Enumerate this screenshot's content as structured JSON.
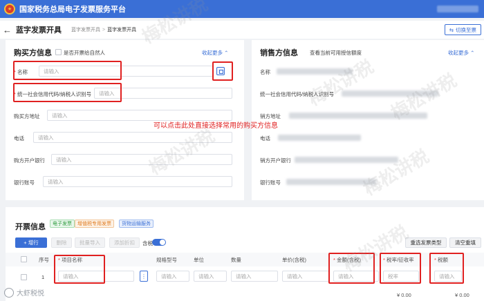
{
  "app": {
    "title": "国家税务总局电子发票服务平台"
  },
  "header": {
    "page_title": "蓝字发票开具",
    "breadcrumb": [
      "蓝字发票开具",
      "蓝字发票开具"
    ],
    "switch_label": "切换至票"
  },
  "buyer": {
    "title": "购买方信息",
    "natural_person_label": "是否开票给自然人",
    "collapse_label": "收起更多 ⌃",
    "fields": [
      {
        "label": "名称",
        "required": true,
        "placeholder": "请输入"
      },
      {
        "label": "统一社会信用代码/纳税人识别号",
        "required": true,
        "placeholder": "请输入"
      },
      {
        "label": "购买方地址",
        "required": false,
        "placeholder": "请输入"
      },
      {
        "label": "电话",
        "required": false,
        "placeholder": "请输入"
      },
      {
        "label": "购方开户银行",
        "required": false,
        "placeholder": "请输入"
      },
      {
        "label": "银行账号",
        "required": false,
        "placeholder": "请输入"
      }
    ],
    "annotation": "可以点击此处直接选择常用的购买方信息"
  },
  "seller": {
    "title": "销售方信息",
    "credit_link": "查看当前可用授信额度",
    "collapse_label": "收起更多 ⌃",
    "fields": [
      {
        "label": "名称"
      },
      {
        "label": "统一社会信用代码/纳税人识别号"
      },
      {
        "label": "销方地址"
      },
      {
        "label": "电话"
      },
      {
        "label": "销方开户银行"
      },
      {
        "label": "银行账号"
      }
    ]
  },
  "invoice": {
    "title": "开票信息",
    "tags": [
      "电子发票",
      "增值税专用发票",
      "货物运输服务"
    ],
    "buttons": {
      "add_row": "+ 增行",
      "delete": "删除",
      "batch_import": "批量导入",
      "add_discount": "添加折扣",
      "tax_included": "含税",
      "reselect_type": "重选发票类型",
      "clear": "清空重填"
    },
    "columns": {
      "index": "序号",
      "item_name": "项目名称",
      "spec": "规格型号",
      "unit": "单位",
      "quantity": "数量",
      "unit_price": "单价(含税)",
      "amount": "金额(含税)",
      "tax_rate": "税率/征收率",
      "tax": "税额"
    },
    "row": {
      "index": "1",
      "item_placeholder": "请输入",
      "dots": "⋮",
      "spec_placeholder": "请输入",
      "unit_placeholder": "请输入",
      "qty_placeholder": "请输入",
      "price_placeholder": "请输入",
      "amount_placeholder": "请输入",
      "rate_placeholder": "税率",
      "tax_placeholder": "请输入"
    },
    "totals": {
      "amount": "¥ 0.00",
      "tax": "¥ 0.00"
    }
  },
  "watermark": "梅松讲税",
  "bottom_brand": "大虾税悦"
}
